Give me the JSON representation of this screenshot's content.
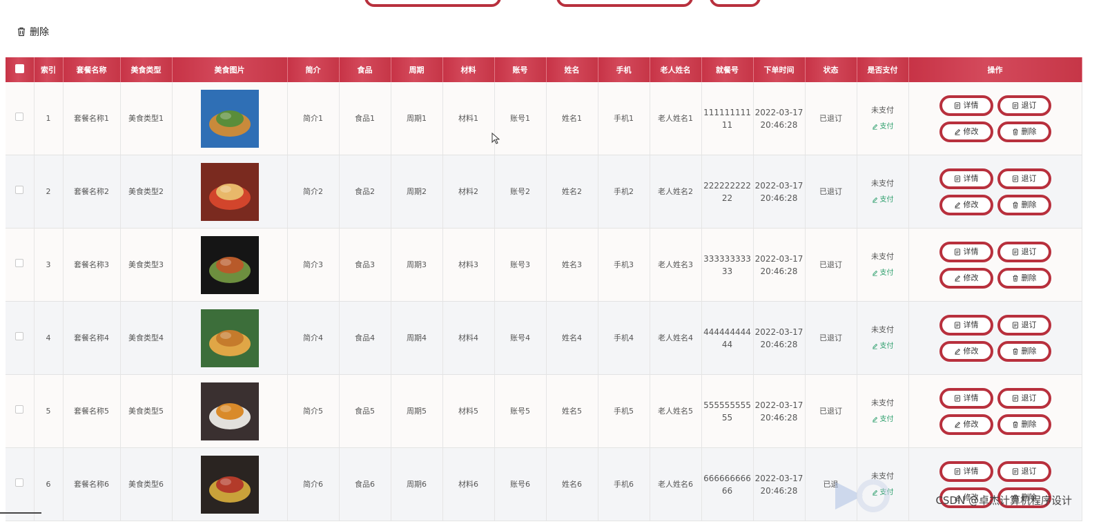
{
  "toolbar": {
    "delete_label": "删除"
  },
  "columns": [
    "索引",
    "套餐名称",
    "美食类型",
    "美食图片",
    "简介",
    "食品",
    "周期",
    "材料",
    "账号",
    "姓名",
    "手机",
    "老人姓名",
    "就餐号",
    "下单时间",
    "状态",
    "是否支付",
    "操作"
  ],
  "rows": [
    {
      "index": "1",
      "package": "套餐名称1",
      "type": "美食类型1",
      "intro": "简介1",
      "food": "食品1",
      "period": "周期1",
      "material": "材料1",
      "account": "账号1",
      "name": "姓名1",
      "phone": "手机1",
      "elder": "老人姓名1",
      "meal_no": "11111111111",
      "time": "2022-03-17 20:46:28",
      "status": "已退订",
      "pay": "未支付",
      "pay_link": "支付"
    },
    {
      "index": "2",
      "package": "套餐名称2",
      "type": "美食类型2",
      "intro": "简介2",
      "food": "食品2",
      "period": "周期2",
      "material": "材料2",
      "account": "账号2",
      "name": "姓名2",
      "phone": "手机2",
      "elder": "老人姓名2",
      "meal_no": "22222222222",
      "time": "2022-03-17 20:46:28",
      "status": "已退订",
      "pay": "未支付",
      "pay_link": "支付"
    },
    {
      "index": "3",
      "package": "套餐名称3",
      "type": "美食类型3",
      "intro": "简介3",
      "food": "食品3",
      "period": "周期3",
      "material": "材料3",
      "account": "账号3",
      "name": "姓名3",
      "phone": "手机3",
      "elder": "老人姓名3",
      "meal_no": "33333333333",
      "time": "2022-03-17 20:46:28",
      "status": "已退订",
      "pay": "未支付",
      "pay_link": "支付"
    },
    {
      "index": "4",
      "package": "套餐名称4",
      "type": "美食类型4",
      "intro": "简介4",
      "food": "食品4",
      "period": "周期4",
      "material": "材料4",
      "account": "账号4",
      "name": "姓名4",
      "phone": "手机4",
      "elder": "老人姓名4",
      "meal_no": "44444444444",
      "time": "2022-03-17 20:46:28",
      "status": "已退订",
      "pay": "未支付",
      "pay_link": "支付"
    },
    {
      "index": "5",
      "package": "套餐名称5",
      "type": "美食类型5",
      "intro": "简介5",
      "food": "食品5",
      "period": "周期5",
      "material": "材料5",
      "account": "账号5",
      "name": "姓名5",
      "phone": "手机5",
      "elder": "老人姓名5",
      "meal_no": "55555555555",
      "time": "2022-03-17 20:46:28",
      "status": "已退订",
      "pay": "未支付",
      "pay_link": "支付"
    },
    {
      "index": "6",
      "package": "套餐名称6",
      "type": "美食类型6",
      "intro": "简介6",
      "food": "食品6",
      "period": "周期6",
      "material": "材料6",
      "account": "账号6",
      "name": "姓名6",
      "phone": "手机6",
      "elder": "老人姓名6",
      "meal_no": "66666666666",
      "time": "2022-03-17 20:46:28",
      "status": "已退",
      "pay": "未支付",
      "pay_link": "支付"
    }
  ],
  "actions": {
    "detail": "详情",
    "unsubscribe": "退订",
    "edit": "修改",
    "delete": "删除"
  },
  "watermark": "CSDN @卓杰计算机程序设计",
  "colors": {
    "accent": "#c73346",
    "button_border": "#b8303d",
    "pay_link": "#2a9d6a"
  }
}
